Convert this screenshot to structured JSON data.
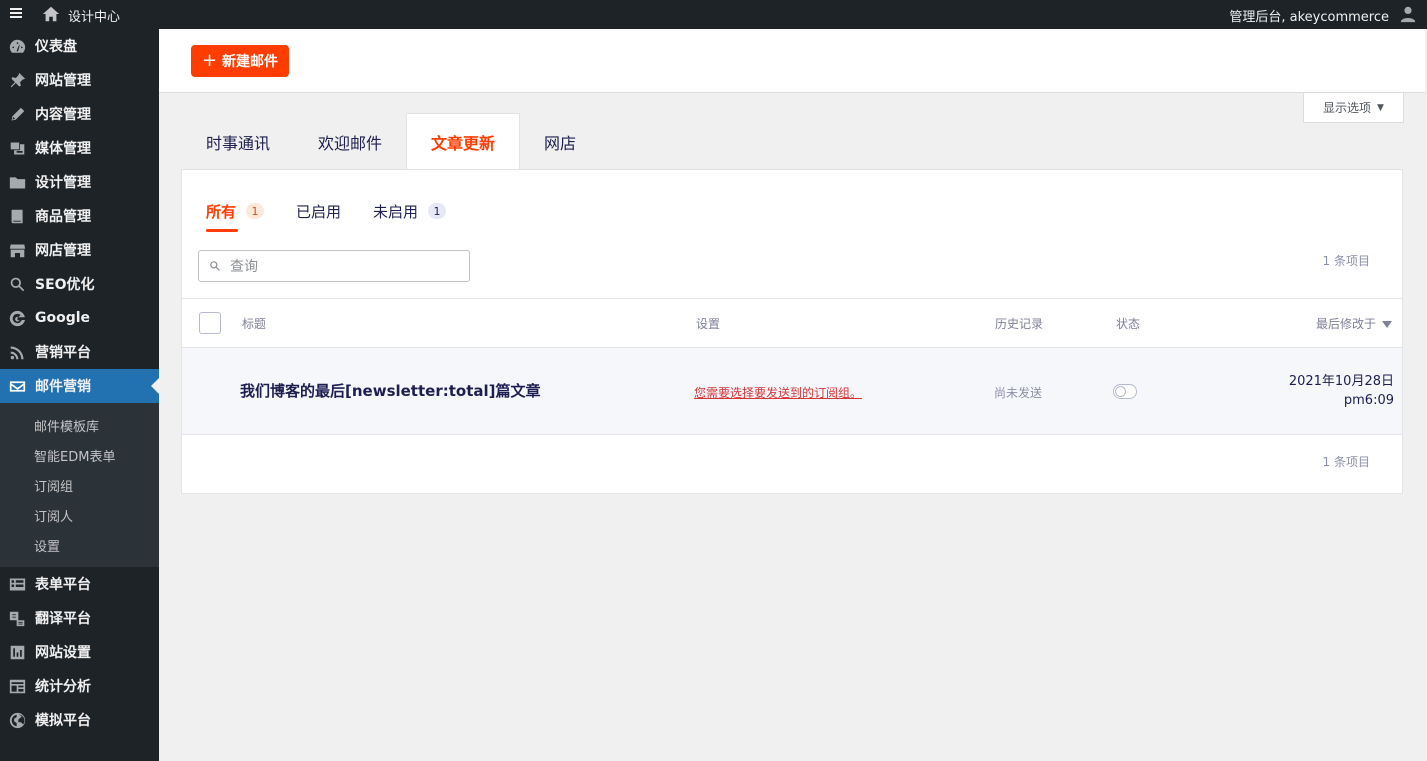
{
  "topbar": {
    "site_name": "设计中心",
    "account_label": "管理后台, akeycommerce"
  },
  "sidebar": {
    "items": [
      {
        "label": "仪表盘",
        "icon": "dashboard-icon"
      },
      {
        "label": "网站管理",
        "icon": "pin-icon"
      },
      {
        "label": "内容管理",
        "icon": "pencil-icon"
      },
      {
        "label": "媒体管理",
        "icon": "media-icon"
      },
      {
        "label": "设计管理",
        "icon": "folder-icon"
      },
      {
        "label": "商品管理",
        "icon": "book-icon"
      },
      {
        "label": "网店管理",
        "icon": "store-icon"
      },
      {
        "label": "SEO优化",
        "icon": "search-icon"
      },
      {
        "label": "Google",
        "icon": "google-icon"
      },
      {
        "label": "营销平台",
        "icon": "rss-icon"
      },
      {
        "label": "邮件营销",
        "icon": "email-icon",
        "active": true
      }
    ],
    "submenu": [
      {
        "label": "邮件模板库"
      },
      {
        "label": "智能EDM表单"
      },
      {
        "label": "订阅组"
      },
      {
        "label": "订阅人"
      },
      {
        "label": "设置"
      }
    ],
    "items_after": [
      {
        "label": "表单平台",
        "icon": "form-icon"
      },
      {
        "label": "翻译平台",
        "icon": "translate-icon"
      },
      {
        "label": "网站设置",
        "icon": "settings-icon"
      },
      {
        "label": "统计分析",
        "icon": "analytics-icon"
      },
      {
        "label": "模拟平台",
        "icon": "globe-icon"
      }
    ]
  },
  "toolbar": {
    "new_email_label": "新建邮件"
  },
  "screen_options": {
    "label": "显示选项"
  },
  "tabs": [
    {
      "label": "时事通讯"
    },
    {
      "label": "欢迎邮件"
    },
    {
      "label": "文章更新",
      "active": true
    },
    {
      "label": "网店"
    }
  ],
  "filters": [
    {
      "label": "所有",
      "count": "1",
      "active": true
    },
    {
      "label": "已启用",
      "count": ""
    },
    {
      "label": "未启用",
      "count": "1"
    }
  ],
  "search": {
    "placeholder": "查询"
  },
  "item_count": "1 条项目",
  "table": {
    "headers": {
      "title": "标题",
      "settings": "设置",
      "history": "历史记录",
      "status": "状态",
      "modified": "最后修改于"
    },
    "rows": [
      {
        "title": "我们博客的最后[newsletter:total]篇文章",
        "settings_warning": "您需要选择要发送到的订阅组。",
        "history": "尚未发送",
        "status_on": false,
        "modified_date": "2021年10月28日",
        "modified_time": "pm6:09"
      }
    ]
  },
  "colors": {
    "accent": "#ff3d00",
    "sidebar_bg": "#1d2327",
    "active_nav": "#2271b1"
  }
}
